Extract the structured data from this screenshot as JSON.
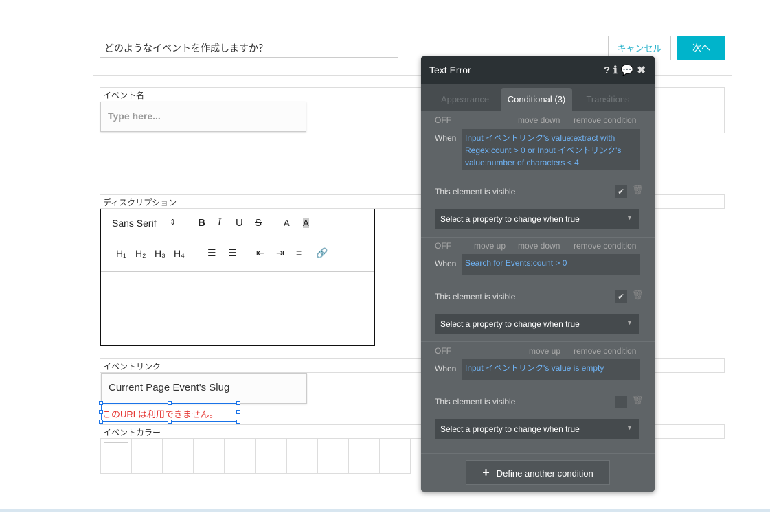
{
  "page": {
    "question": "どのようなイベントを作成しますか？",
    "cancel": "キャンセル",
    "next": "次へ",
    "event_name_label": "イベント名",
    "event_name_placeholder": "Type here...",
    "description_label": "ディスクリプション",
    "editor": {
      "font": "Sans Serif",
      "headings": [
        "H₁",
        "H₂",
        "H₃",
        "H₄"
      ]
    },
    "event_link_label": "イベントリンク",
    "event_link_value": "Current Page Event's Slug",
    "error_text": "このURLは利用できません。",
    "event_color_label": "イベントカラー"
  },
  "panel": {
    "title": "Text Error",
    "tabs": [
      "Appearance",
      "Conditional (3)",
      "Transitions"
    ],
    "active_tab": "Conditional (3)",
    "off": "OFF",
    "move_up": "move up",
    "move_down": "move down",
    "remove": "remove condition",
    "when": "When",
    "visible_label": "This element is visible",
    "select_placeholder": "Select a property to change when true",
    "conditions": [
      {
        "expr": "Input イベントリンク's value:extract with Regex:count > 0 or Input イベントリンク's value:number of characters < 4",
        "visible": true
      },
      {
        "expr": "Search for Events:count > 0",
        "visible": true
      },
      {
        "expr": "Input イベントリンク's value is empty",
        "visible": false
      }
    ],
    "define": "Define another condition"
  },
  "colors": {
    "accent": "#00b4cb",
    "error": "#e53935",
    "link": "#6fb3f5"
  }
}
